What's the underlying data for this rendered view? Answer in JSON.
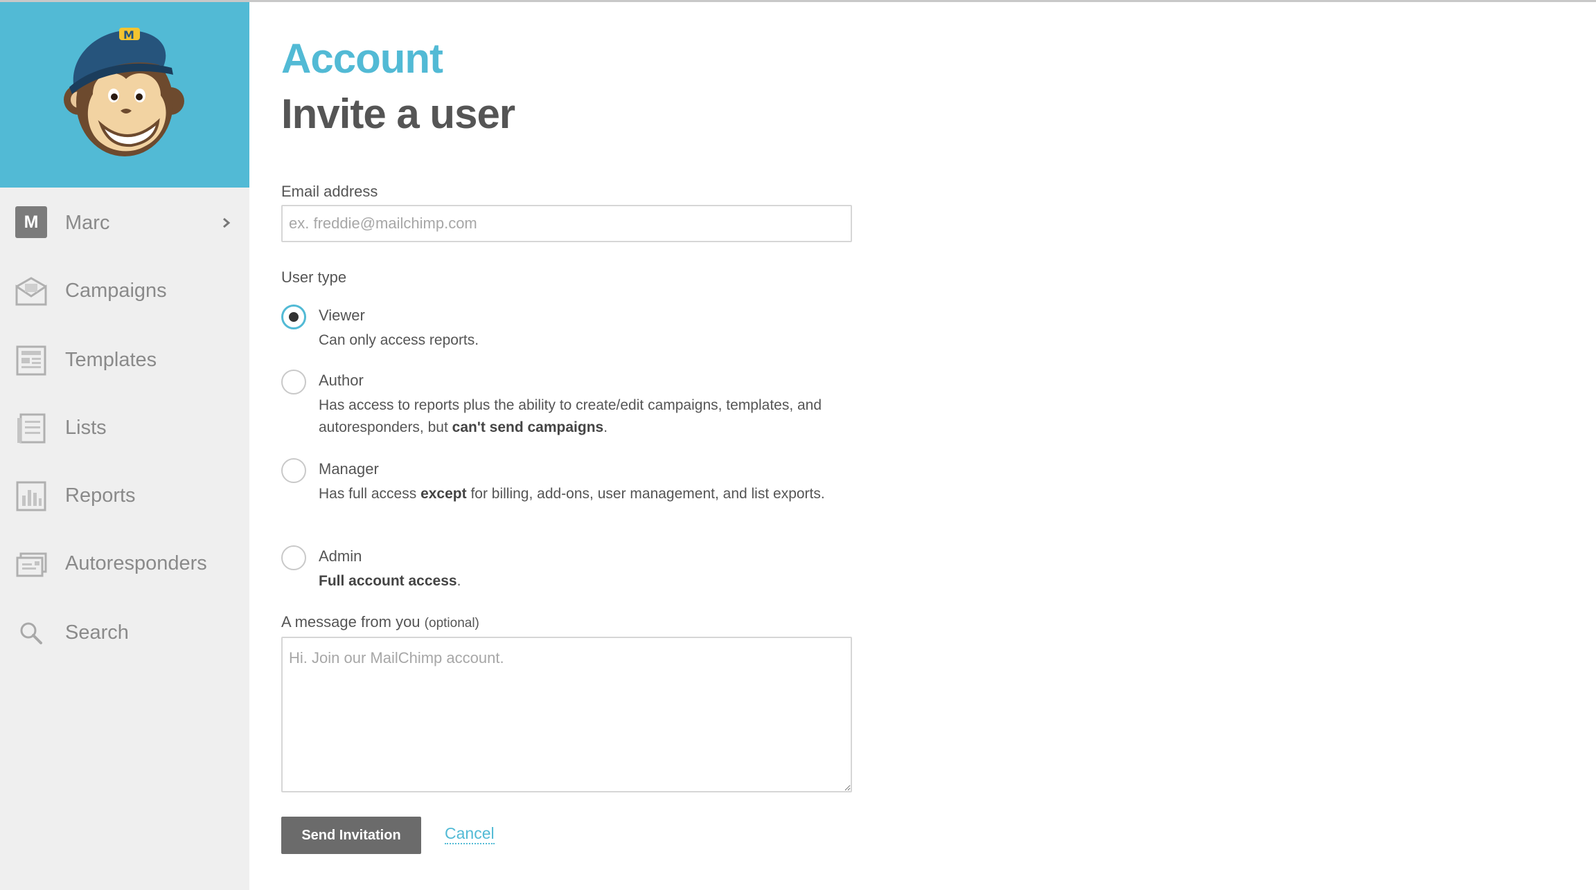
{
  "sidebar": {
    "user": {
      "initial": "M",
      "name": "Marc"
    },
    "items": [
      {
        "label": "Campaigns",
        "icon": "envelope-icon"
      },
      {
        "label": "Templates",
        "icon": "template-icon"
      },
      {
        "label": "Lists",
        "icon": "list-icon"
      },
      {
        "label": "Reports",
        "icon": "bar-chart-icon"
      },
      {
        "label": "Autoresponders",
        "icon": "autoresponder-icon"
      },
      {
        "label": "Search",
        "icon": "search-icon"
      }
    ]
  },
  "header": {
    "kicker": "Account",
    "title": "Invite a user"
  },
  "form": {
    "email": {
      "label": "Email address",
      "placeholder": "ex. freddie@mailchimp.com",
      "value": ""
    },
    "user_type": {
      "label": "User type",
      "selected": "Viewer",
      "options": [
        {
          "title": "Viewer",
          "desc": "Can only access reports."
        },
        {
          "title": "Author",
          "desc_1": "Has access to reports plus the ability to create/edit campaigns, templates, and autoresponders, but ",
          "desc_bold": "can't send campaigns",
          "desc_2": "."
        },
        {
          "title": "Manager",
          "desc_1": "Has full access ",
          "desc_bold": "except",
          "desc_2": " for billing, add-ons, user management, and list exports."
        },
        {
          "title": "Admin",
          "desc_bold": "Full account access",
          "desc_2": "."
        }
      ]
    },
    "message": {
      "label": "A message from you",
      "label_optional": "(optional)",
      "placeholder": "Hi. Join our MailChimp account.",
      "value": ""
    },
    "send_label": "Send Invitation",
    "cancel_label": "Cancel"
  },
  "colors": {
    "accent": "#52bad5",
    "button": "#6b6b6b",
    "sidebar_bg": "#efefef",
    "heading": "#555555"
  }
}
